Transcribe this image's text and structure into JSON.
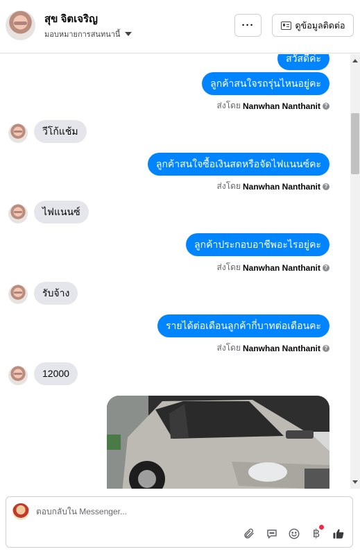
{
  "header": {
    "contact_name": "สุข จิตเจริญ",
    "assign_label": "มอบหมายการสนทนานี้",
    "more_label": "···",
    "contact_info_label": "ดูข้อมูลติดต่อ"
  },
  "messages": [
    {
      "type": "out",
      "text": "สวัสดีค่ะ"
    },
    {
      "type": "out",
      "text": "ลูกค้าสนใจรถรุ่นไหนอยู่คะ"
    },
    {
      "type": "sent_by",
      "prefix": "ส่งโดย",
      "name": "Nanwhan Nanthanit"
    },
    {
      "type": "in",
      "text": "วีโก้แช้ม"
    },
    {
      "type": "out",
      "text": "ลูกค้าสนใจซื้อเงินสดหรือจัดไฟแนนซ์คะ"
    },
    {
      "type": "sent_by",
      "prefix": "ส่งโดย",
      "name": "Nanwhan Nanthanit"
    },
    {
      "type": "in",
      "text": "ไฟแนนซ์"
    },
    {
      "type": "out",
      "text": "ลูกค้าประกอบอาชีพอะไรอยู่คะ"
    },
    {
      "type": "sent_by",
      "prefix": "ส่งโดย",
      "name": "Nanwhan Nanthanit"
    },
    {
      "type": "in",
      "text": "รับจ้าง"
    },
    {
      "type": "out",
      "text": "รายได้ต่อเดือนลูกค้ากี่บาทต่อเดือนคะ"
    },
    {
      "type": "sent_by",
      "prefix": "ส่งโดย",
      "name": "Nanwhan Nanthanit"
    },
    {
      "type": "in",
      "text": "12000"
    }
  ],
  "composer": {
    "placeholder": "ตอบกลับใน Messenger..."
  },
  "icons": {
    "info": "info-icon",
    "attach": "paperclip-icon",
    "saved_reply": "chat-bubble-icon",
    "emoji": "emoji-icon",
    "payment": "baht-icon",
    "like": "thumbs-up-icon"
  },
  "colors": {
    "outgoing_bubble": "#0084ff",
    "incoming_bubble": "#e4e6eb",
    "notification_dot": "#f02849"
  }
}
